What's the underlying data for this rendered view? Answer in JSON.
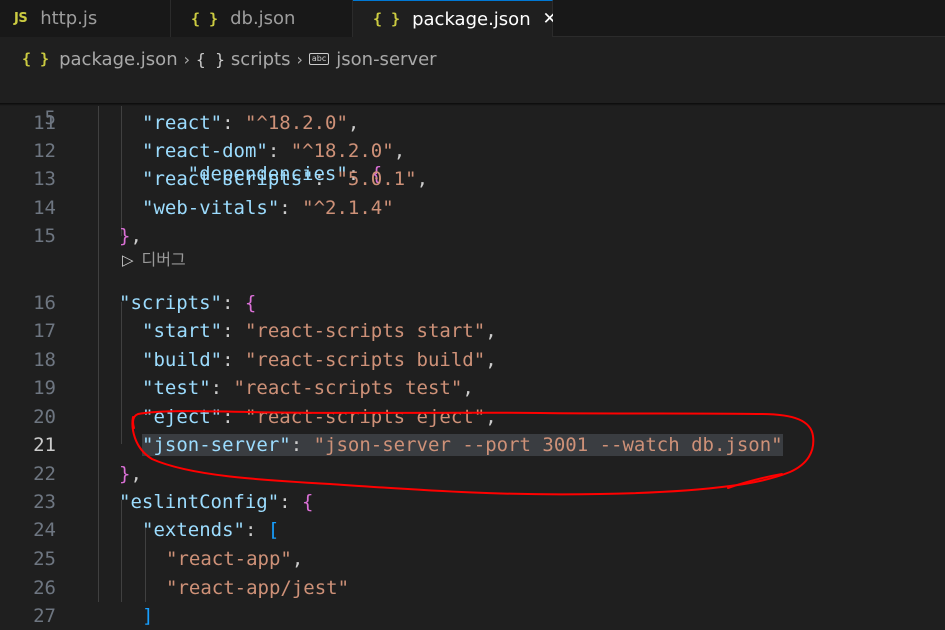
{
  "tabs": [
    {
      "icon": "js-file-icon",
      "icon_text": "JS",
      "label": "http.js",
      "active": false
    },
    {
      "icon": "json-file-icon",
      "icon_text": "{ }",
      "label": "db.json",
      "active": false
    },
    {
      "icon": "json-file-icon",
      "icon_text": "{ }",
      "label": "package.json",
      "active": true,
      "close": "✕"
    }
  ],
  "breadcrumb": {
    "file_icon_text": "{ }",
    "file": "package.json",
    "sep": "›",
    "section_icon_text": "{ }",
    "section": "scripts",
    "symbol_icon_text": "abc",
    "symbol": "json-server"
  },
  "codelens": {
    "play_icon": "▷",
    "label": "디버그"
  },
  "colors": {
    "key": "#9cdcfe",
    "string": "#ce9178",
    "brace": "#da70d6",
    "bracket": "#179fff",
    "annotation": "#ff0000"
  },
  "editor": {
    "sticky_line": {
      "num": "5",
      "key": "\"dependencies\"",
      "rest": ": ",
      "open": "{"
    },
    "lines": [
      {
        "num": "11",
        "key": "\"react\"",
        "sep": ": ",
        "val": "\"^18.2.0\"",
        "tail": ","
      },
      {
        "num": "12",
        "key": "\"react-dom\"",
        "sep": ": ",
        "val": "\"^18.2.0\"",
        "tail": ","
      },
      {
        "num": "13",
        "key": "\"react-scripts\"",
        "sep": ": ",
        "val": "\"5.0.1\"",
        "tail": ","
      },
      {
        "num": "14",
        "key": "\"web-vitals\"",
        "sep": ": ",
        "val": "\"^2.1.4\"",
        "tail": ""
      },
      {
        "num": "15",
        "close": "}",
        "tail": ","
      },
      {
        "num": "16",
        "key": "\"scripts\"",
        "sep": ": ",
        "open": "{"
      },
      {
        "num": "17",
        "key": "\"start\"",
        "sep": ": ",
        "val": "\"react-scripts start\"",
        "tail": ","
      },
      {
        "num": "18",
        "key": "\"build\"",
        "sep": ": ",
        "val": "\"react-scripts build\"",
        "tail": ","
      },
      {
        "num": "19",
        "key": "\"test\"",
        "sep": ": ",
        "val": "\"react-scripts test\"",
        "tail": ","
      },
      {
        "num": "20",
        "key": "\"eject\"",
        "sep": ": ",
        "val": "\"react-scripts eject\"",
        "tail": ","
      },
      {
        "num": "21",
        "key": "\"json-server\"",
        "sep": ": ",
        "val": "\"json-server --port 3001 --watch db.json\"",
        "tail": ""
      },
      {
        "num": "22",
        "close": "}",
        "tail": ","
      },
      {
        "num": "23",
        "key": "\"eslintConfig\"",
        "sep": ": ",
        "open": "{"
      },
      {
        "num": "24",
        "key": "\"extends\"",
        "sep": ": ",
        "openb": "["
      },
      {
        "num": "25",
        "val": "\"react-app\"",
        "tail": ","
      },
      {
        "num": "26",
        "val": "\"react-app/jest\"",
        "tail": ""
      },
      {
        "num": "27",
        "closeb": "]",
        "tail": ""
      }
    ],
    "active_line": "21"
  }
}
